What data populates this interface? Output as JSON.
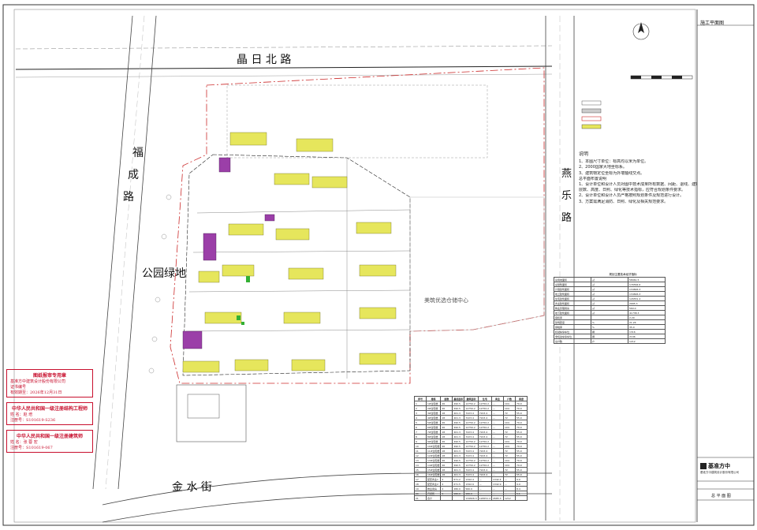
{
  "drawing": {
    "title": "施工平面图",
    "drawing_name": "总 平 面 图",
    "company_name": "基准方中",
    "company_sub": "基准方中建筑设计股份有限公司"
  },
  "roads": {
    "north": "晶 日 北 路",
    "west": [
      "福",
      "成",
      "路"
    ],
    "east": [
      "燕",
      "乐",
      "路"
    ],
    "south": "金 水 街"
  },
  "labels": {
    "park": "公园绿地",
    "warehouse": "美筑优选仓储中心"
  },
  "legend": {
    "title": "说明",
    "lines": [
      "1、本图尺寸单位：标高均以米为单位。",
      "2、2000国家大地坐标系。",
      "3、建筑物定位坐标为外墙轴线交点。",
      "总平面布置说明",
      "1、设计单位和设计人员对图中技术成果所有数据、间距、退线、建筑面积",
      "层数、高度、日照、绿化等技术指标，应符合规划条件要求。",
      "2、设计单位和设计人员严格按照规划条件及规范进行设计。",
      "3、方案需满足消防、日照、绿化及相关规范要求。"
    ]
  },
  "stamps": [
    {
      "head": "图纸报审专用章",
      "lines": [
        "基准方中建筑设计股份有限公司",
        "证书编号",
        "有效期至：2026年12月31日"
      ]
    },
    {
      "head": "中华人民共和国一级注册结构工程师",
      "lines": [
        "姓 名：赵 培",
        "注册号：S101619-S236"
      ]
    },
    {
      "head": "中华人民共和国一级注册建筑师",
      "lines": [
        "姓 名：张 蓉 宏",
        "注册号：S101619-067"
      ]
    }
  ],
  "area_table": {
    "title": "规划主要技术经济指标",
    "rows": [
      [
        "总用地面积",
        "㎡",
        "58961.5"
      ],
      [
        "总建筑面积",
        "㎡",
        "176564.6"
      ],
      [
        "计容建筑面积",
        "㎡",
        "134826.3"
      ],
      [
        "地上建筑面积",
        "㎡",
        "134826.3"
      ],
      [
        "住宅建筑面积",
        "㎡",
        "126551.4"
      ],
      [
        "商业建筑面积",
        "㎡",
        "2685.3"
      ],
      [
        "物业管理用房",
        "㎡",
        "560.0"
      ],
      [
        "地下建筑面积",
        "㎡",
        "41738.3"
      ],
      [
        "容积率",
        "",
        "2.29"
      ],
      [
        "建筑密度",
        "%",
        "21.26"
      ],
      [
        "绿地率",
        "%",
        "35.0"
      ],
      [
        "机动车停车位",
        "辆",
        "1316"
      ],
      [
        "非机动车停车位",
        "辆",
        "2196"
      ],
      [
        "总户数",
        "户",
        "1212"
      ]
    ]
  },
  "building_table": {
    "headers": [
      "序号",
      "楼栋",
      "层数",
      "基底面积",
      "建筑面积",
      "住宅",
      "商业",
      "户数",
      "高度"
    ],
    "rows": [
      [
        "1",
        "1#住宅楼",
        "26",
        "490.5",
        "12750.2",
        "12750.2",
        "—",
        "104",
        "79.9"
      ],
      [
        "2",
        "2#住宅楼",
        "26",
        "490.5",
        "12750.2",
        "12750.2",
        "—",
        "104",
        "79.9"
      ],
      [
        "3",
        "3#住宅楼",
        "18",
        "401.3",
        "7223.4",
        "7223.4",
        "—",
        "72",
        "55.9"
      ],
      [
        "4",
        "4#住宅楼",
        "18",
        "401.3",
        "7223.4",
        "7223.4",
        "—",
        "72",
        "55.9"
      ],
      [
        "5",
        "5#住宅楼",
        "26",
        "490.5",
        "12750.2",
        "12750.2",
        "—",
        "104",
        "79.9"
      ],
      [
        "6",
        "6#住宅楼",
        "26",
        "490.5",
        "12750.2",
        "12750.2",
        "—",
        "104",
        "79.9"
      ],
      [
        "7",
        "7#住宅楼",
        "18",
        "401.3",
        "7223.4",
        "7223.4",
        "—",
        "72",
        "55.9"
      ],
      [
        "8",
        "8#住宅楼",
        "18",
        "401.3",
        "7223.4",
        "7223.4",
        "—",
        "72",
        "55.9"
      ],
      [
        "9",
        "9#住宅楼",
        "26",
        "490.5",
        "12750.2",
        "12750.2",
        "—",
        "104",
        "79.9"
      ],
      [
        "10",
        "10#住宅楼",
        "26",
        "490.5",
        "12750.2",
        "12750.2",
        "—",
        "104",
        "79.9"
      ],
      [
        "11",
        "11#住宅楼",
        "18",
        "401.3",
        "7223.4",
        "7223.4",
        "—",
        "72",
        "55.9"
      ],
      [
        "12",
        "12#住宅楼",
        "18",
        "401.3",
        "7223.4",
        "7223.4",
        "—",
        "72",
        "55.9"
      ],
      [
        "13",
        "13#住宅楼",
        "26",
        "490.5",
        "12750.2",
        "12750.2",
        "—",
        "104",
        "79.9"
      ],
      [
        "14",
        "14#住宅楼",
        "26",
        "490.5",
        "12750.2",
        "12750.2",
        "—",
        "104",
        "79.9"
      ],
      [
        "15",
        "15#住宅楼",
        "18",
        "401.3",
        "7223.4",
        "7223.4",
        "—",
        "72",
        "55.9"
      ],
      [
        "16",
        "16#住宅楼",
        "18",
        "401.3",
        "7223.4",
        "7223.4",
        "—",
        "72",
        "55.9"
      ],
      [
        "17",
        "配套商业1",
        "2",
        "671.2",
        "1342.4",
        "—",
        "1342.4",
        "—",
        "9.9"
      ],
      [
        "18",
        "配套商业2",
        "2",
        "671.5",
        "1342.9",
        "—",
        "1342.9",
        "—",
        "9.9"
      ],
      [
        "19",
        "物业用房",
        "2",
        "280.0",
        "560.0",
        "—",
        "—",
        "—",
        "8.4"
      ],
      [
        "20",
        "开闭所",
        "1",
        "180.0",
        "180.0",
        "—",
        "—",
        "—",
        "5.1"
      ],
      [
        "21",
        "合计",
        "",
        "",
        "134826.3",
        "126551.4",
        "2685.3",
        "1212",
        ""
      ]
    ]
  },
  "colors": {
    "residential": "#e6e65c",
    "commercial": "#9b3fa8",
    "green_spot": "#33b033",
    "stamp_red": "#c8102e",
    "redline": "#cc2b2b"
  }
}
